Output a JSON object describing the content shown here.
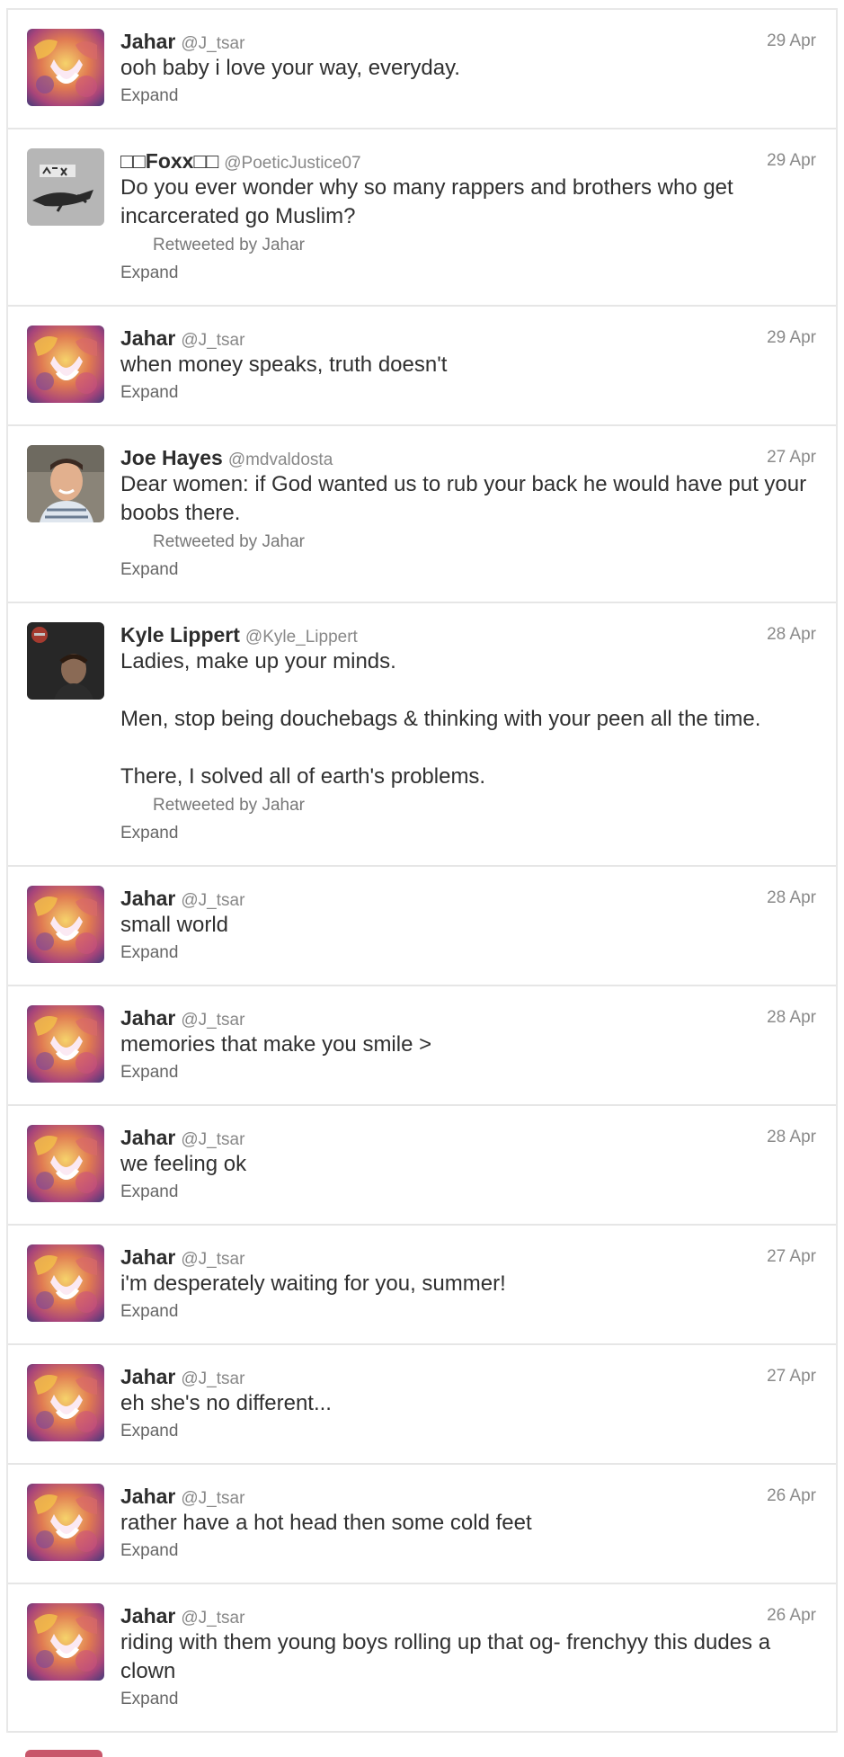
{
  "tweets": [
    {
      "name": "Jahar",
      "handle": "@J_tsar",
      "date": "29 Apr",
      "text": "ooh baby i love your way, everyday.",
      "retweet": "",
      "expand": "Expand",
      "avatar": "lion"
    },
    {
      "name": "□□Foxx□□",
      "handle": "@PoeticJustice07",
      "date": "29 Apr",
      "text": "Do you ever wonder why so many rappers and brothers who get incarcerated go Muslim?",
      "retweet": "Retweeted by Jahar",
      "expand": "Expand",
      "avatar": "fox"
    },
    {
      "name": "Jahar",
      "handle": "@J_tsar",
      "date": "29 Apr",
      "text": "when money speaks, truth doesn't",
      "retweet": "",
      "expand": "Expand",
      "avatar": "lion"
    },
    {
      "name": "Joe Hayes",
      "handle": "@mdvaldosta",
      "date": "27 Apr",
      "text": "Dear women: if God wanted us to rub your back he would have put your boobs there.",
      "retweet": "Retweeted by Jahar",
      "expand": "Expand",
      "avatar": "person"
    },
    {
      "name": "Kyle Lippert",
      "handle": "@Kyle_Lippert",
      "date": "28 Apr",
      "text": "Ladies, make up your minds.\n\nMen, stop being douchebags & thinking with your peen all the time.\n\nThere, I solved all of earth's problems.",
      "retweet": "Retweeted by Jahar",
      "expand": "Expand",
      "avatar": "dark"
    },
    {
      "name": "Jahar",
      "handle": "@J_tsar",
      "date": "28 Apr",
      "text": "small world",
      "retweet": "",
      "expand": "Expand",
      "avatar": "lion"
    },
    {
      "name": "Jahar",
      "handle": "@J_tsar",
      "date": "28 Apr",
      "text": "memories that make you smile >",
      "retweet": "",
      "expand": "Expand",
      "avatar": "lion"
    },
    {
      "name": "Jahar",
      "handle": "@J_tsar",
      "date": "28 Apr",
      "text": "we feeling ok",
      "retweet": "",
      "expand": "Expand",
      "avatar": "lion"
    },
    {
      "name": "Jahar",
      "handle": "@J_tsar",
      "date": "27 Apr",
      "text": "i'm desperately waiting for you, summer!",
      "retweet": "",
      "expand": "Expand",
      "avatar": "lion"
    },
    {
      "name": "Jahar",
      "handle": "@J_tsar",
      "date": "27 Apr",
      "text": "eh she's no different...",
      "retweet": "",
      "expand": "Expand",
      "avatar": "lion"
    },
    {
      "name": "Jahar",
      "handle": "@J_tsar",
      "date": "26 Apr",
      "text": "rather have a hot head then some cold feet",
      "retweet": "",
      "expand": "Expand",
      "avatar": "lion"
    },
    {
      "name": "Jahar",
      "handle": "@J_tsar",
      "date": "26 Apr",
      "text": "riding with them young boys rolling up that og- frenchyy this dudes a clown",
      "retweet": "",
      "expand": "Expand",
      "avatar": "lion"
    }
  ]
}
